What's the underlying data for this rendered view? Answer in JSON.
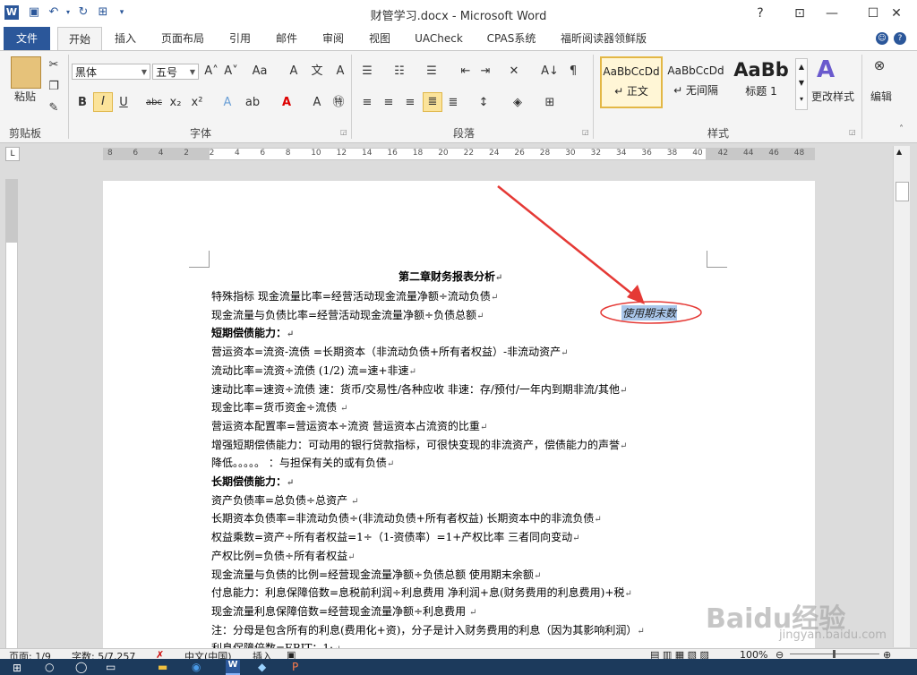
{
  "window": {
    "title": "财管学习.docx - Microsoft Word"
  },
  "tabs": [
    "文件",
    "开始",
    "插入",
    "页面布局",
    "引用",
    "邮件",
    "审阅",
    "视图",
    "UACheck",
    "CPAS系统",
    "福昕阅读器领鲜版"
  ],
  "ribbon": {
    "clipboard": {
      "paste": "粘贴",
      "group": "剪贴板"
    },
    "font": {
      "name": "黑体",
      "size": "五号",
      "group": "字体"
    },
    "paragraph": {
      "group": "段落"
    },
    "styles": {
      "group": "样式",
      "items": [
        {
          "preview": "AaBbCcDd",
          "name": "↵ 正文"
        },
        {
          "preview": "AaBbCcDd",
          "name": "↵ 无间隔"
        },
        {
          "preview": "AaBb",
          "name": "标题 1"
        }
      ],
      "change": "更改样式"
    },
    "editing": {
      "label": "编辑"
    }
  },
  "ruler": {
    "numbers": [
      "8",
      "6",
      "4",
      "2",
      "2",
      "4",
      "6",
      "8",
      "10",
      "12",
      "14",
      "16",
      "18",
      "20",
      "22",
      "24",
      "26",
      "28",
      "30",
      "32",
      "34",
      "36",
      "38",
      "40",
      "42",
      "44",
      "46",
      "48"
    ]
  },
  "document": {
    "title": "第二章财务报表分析",
    "lines": [
      {
        "text": "特殊指标    现金流量比率=经营活动现金流量净额÷流动负债",
        "bold": false
      },
      {
        "text": "            现金流量与负债比率=经营活动现金流量净额÷负债总额",
        "bold": false
      },
      {
        "text": "短期偿债能力：",
        "bold": true
      },
      {
        "text": "营运资本=流资-流债  =长期资本（非流动负债+所有者权益）-非流动资产",
        "bold": false
      },
      {
        "text": "流动比率=流资÷流债       (1/2) 流=速+非速",
        "bold": false
      },
      {
        "text": "速动比率=速资÷流债   速：货币/交易性/各种应收  非速：存/预付/一年内到期非流/其他",
        "bold": false
      },
      {
        "text": "现金比率=货币资金÷流债  ",
        "bold": false
      },
      {
        "text": "营运资本配置率=营运资本÷流资    营运资本占流资的比重",
        "bold": false
      },
      {
        "text": "增强短期偿债能力：可动用的银行贷款指标，可很快变现的非流资产，偿债能力的声誉",
        "bold": false
      },
      {
        "text": "降低。。。。。        ：与担保有关的或有负债",
        "bold": false
      },
      {
        "text": "长期偿债能力：",
        "bold": true
      },
      {
        "text": "资产负债率=总负债÷总资产    ",
        "bold": false
      },
      {
        "text": "长期资本负债率=非流动负债÷(非流动负债+所有者权益) 长期资本中的非流负债",
        "bold": false
      },
      {
        "text": "权益乘数=资产÷所有者权益=1÷（1-资债率）=1+产权比率    三者同向变动",
        "bold": false
      },
      {
        "text": "产权比例=负债÷所有者权益",
        "bold": false
      },
      {
        "text": "现金流量与负债的比例=经营现金流量净额÷负债总额     使用期末余额",
        "bold": false
      },
      {
        "text": "付息能力：利息保障倍数=息税前利润÷利息费用    净利润+息(财务费用的利息费用)+税",
        "bold": false
      },
      {
        "text": "  现金流量利息保障倍数=经营现金流量净额÷利息费用       ",
        "bold": false
      },
      {
        "text": "注：分母是包含所有的利息(费用化+资)，分子是计入财务费用的利息（因为其影响利润）",
        "bold": false
      },
      {
        "text": "利息保障倍数=EBIT：1:",
        "bold": false
      }
    ],
    "annotation": "使用期末数"
  },
  "status": {
    "page": "页面: 1/9",
    "words": "字数: 5/7,257",
    "lang": "中文(中国)",
    "mode": "插入",
    "zoom": "100%"
  },
  "watermark": {
    "brand": "Baidu经验",
    "url": "jingyan.baidu.com"
  }
}
